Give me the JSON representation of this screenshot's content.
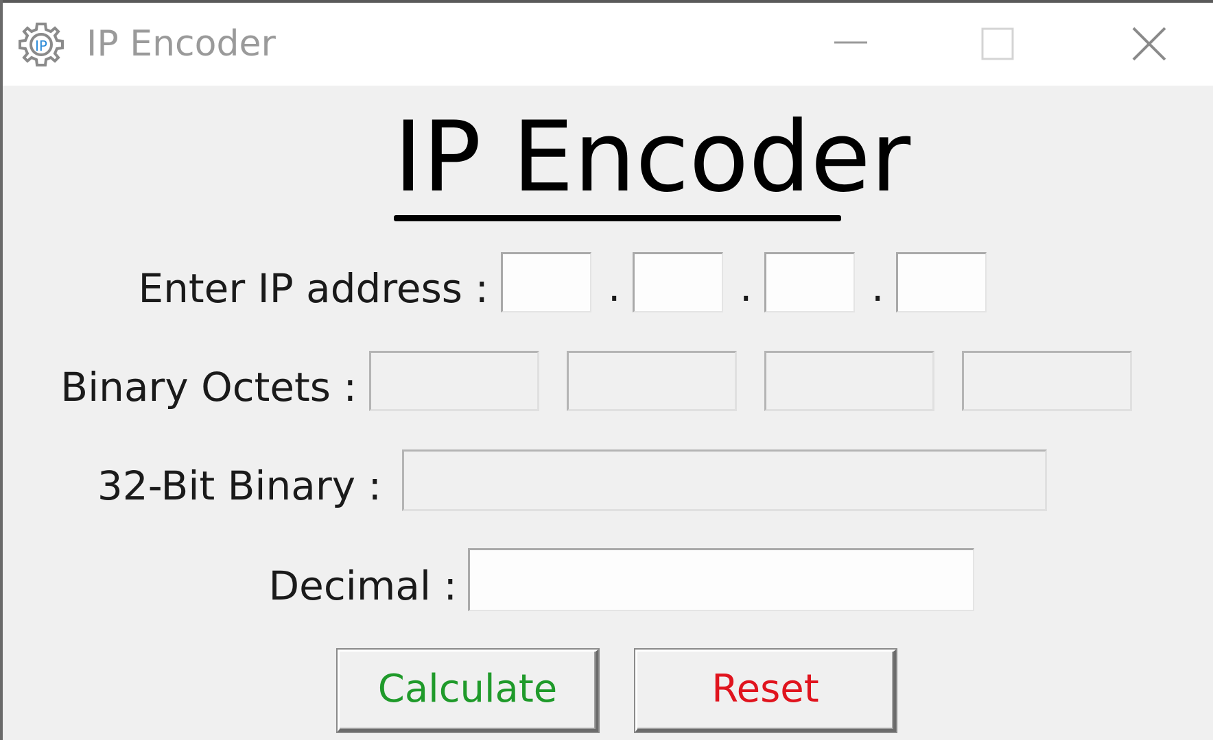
{
  "window": {
    "title": "IP Encoder",
    "controls": {
      "minimize_icon": "minimize-icon",
      "maximize_icon": "maximize-icon",
      "close_icon": "close-icon"
    }
  },
  "app_icon": "gear-icon",
  "heading": "IP Encoder",
  "form": {
    "ip_label": "Enter IP address :",
    "ip_separator": ".",
    "ip_octets": [
      "",
      "",
      "",
      ""
    ],
    "binary_octets_label": "Binary Octets :",
    "binary_octets": [
      "",
      "",
      "",
      ""
    ],
    "binary32_label": "32-Bit Binary :",
    "binary32_value": "",
    "decimal_label": "Decimal :",
    "decimal_value": ""
  },
  "buttons": {
    "calculate": "Calculate",
    "reset": "Reset"
  },
  "colors": {
    "calculate_text": "#1f9a2a",
    "reset_text": "#e0141e",
    "window_bg": "#f0f0f0",
    "titlebar_bg": "#ffffff"
  }
}
